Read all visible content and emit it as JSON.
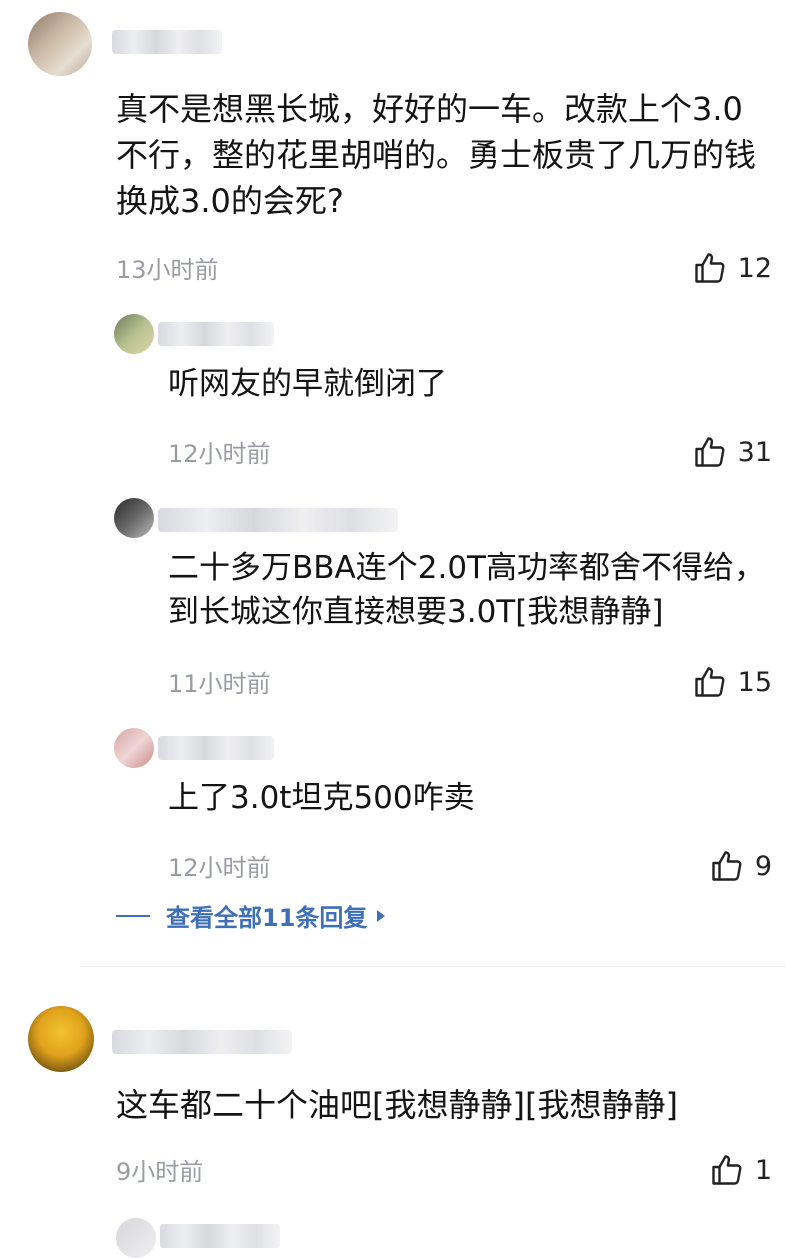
{
  "comment1": {
    "text": "真不是想黑长城，好好的一车。改款上个3.0不行，整的花里胡哨的。勇士板贵了几万的钱换成3.0的会死?",
    "time": "13小时前",
    "likes": "12"
  },
  "replies": [
    {
      "text": "听网友的早就倒闭了",
      "time": "12小时前",
      "likes": "31"
    },
    {
      "text": "二十多万BBA连个2.0T高功率都舍不得给，到长城这你直接想要3.0T[我想静静]",
      "time": "11小时前",
      "likes": "15"
    },
    {
      "text": "上了3.0t坦克500咋卖",
      "time": "12小时前",
      "likes": "9"
    }
  ],
  "expand_replies": {
    "label": "查看全部11条回复",
    "icon": "caret-right-icon"
  },
  "comment2": {
    "text": "这车都二十个油吧[我想静静][我想静静]",
    "time": "9小时前",
    "likes": "1"
  },
  "icons": {
    "like": "thumbs-up-icon"
  },
  "colors": {
    "link": "#3f6fb6",
    "time": "#9a9ca3"
  }
}
